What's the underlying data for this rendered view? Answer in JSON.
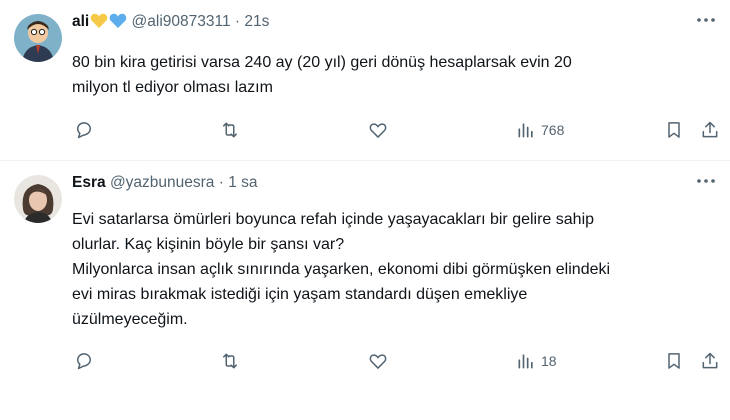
{
  "tweets": [
    {
      "name": "ali",
      "handle": "@ali90873311",
      "separator": "·",
      "time": "21s",
      "text": "80 bin kira getirisi varsa 240 ay (20 yıl) geri dönüş hesaplarsak evin 20\nmilyon tl ediyor olması lazım",
      "views": "768",
      "badges": [
        "yellow-heart-icon",
        "blue-heart-icon"
      ]
    },
    {
      "name": "Esra",
      "handle": "@yazbunuesra",
      "separator": "·",
      "time": "1 sa",
      "text": "Evi satarlarsa ömürleri boyunca refah içinde yaşayacakları bir gelire sahip\nolurlar. Kaç kişinin böyle bir şansı var?\nMilyonlarca insan açlık sınırında yaşarken, ekonomi dibi görmüşken elindeki\nevi miras bırakmak istediği için yaşam standardı düşen emekliye\nüzülmeyeceğim.",
      "views": "18"
    }
  ],
  "colors": {
    "text": "#0f1419",
    "muted": "#536471",
    "divider": "#eff3f4",
    "yellow_heart": "#f7c948",
    "blue_heart": "#5dadec"
  }
}
